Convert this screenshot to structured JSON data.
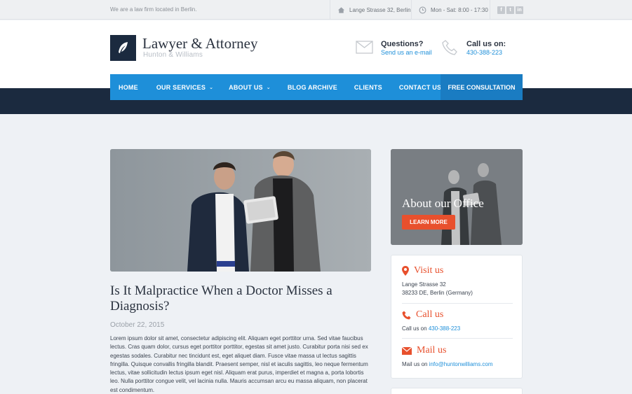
{
  "topbar": {
    "tagline": "We are a law firm located in Berlin.",
    "address": "Lange Strasse 32, Berlin",
    "hours": "Mon - Sat: 8:00 - 17:30",
    "social": [
      "f",
      "t",
      "in"
    ]
  },
  "header": {
    "logo_title": "Lawyer & Attorney",
    "logo_subtitle": "Hunton & Williams",
    "questions_label": "Questions?",
    "questions_link": "Send us an e-mail",
    "call_label": "Call us on:",
    "call_number": "430-388-223"
  },
  "nav": {
    "items": [
      {
        "label": "HOME",
        "dropdown": false
      },
      {
        "label": "OUR SERVICES",
        "dropdown": true
      },
      {
        "label": "ABOUT US",
        "dropdown": true
      },
      {
        "label": "BLOG ARCHIVE",
        "dropdown": false
      },
      {
        "label": "CLIENTS",
        "dropdown": false
      },
      {
        "label": "CONTACT US",
        "dropdown": false
      }
    ],
    "cta": "FREE CONSULTATION"
  },
  "post": {
    "title": "Is It Malpractice When a Doctor Misses a Diagnosis?",
    "date": "October 22, 2015",
    "body": "Lorem ipsum dolor sit amet, consectetur adipiscing elit. Aliquam eget porttitor urna. Sed vitae faucibus lectus. Cras quam dolor, cursus eget porttitor porttitor, egestas sit amet justo. Curabitur porta nisi sed ex egestas sodales. Curabitur nec tincidunt est, eget aliquet diam. Fusce vitae massa ut lectus sagittis fringilla. Quisque convallis fringilla blandit. Praesent semper, nisl et iaculis sagittis, leo neque fermentum lectus, vitae sollicitudin lectus ipsum eget nisl. Aliquam erat purus, imperdiet et magna a, porta lobortis leo. Nulla porttitor congue velit, vel lacinia nulla. Mauris accumsan arcu eu massa aliquam, non placerat est condimentum."
  },
  "sidebar": {
    "office_title": "About our Office",
    "office_button": "LEARN MORE",
    "visit_heading": "Visit us",
    "visit_line1": "Lange Strasse 32",
    "visit_line2": "38233 DE, Berlin (Germany)",
    "call_heading": "Call us",
    "call_prefix": "Call us on",
    "call_number": "430-388-223",
    "mail_heading": "Mail us",
    "mail_prefix": "Mail us on",
    "mail_address": "info@huntonwilliams.com"
  },
  "colors": {
    "navy": "#1b2a3f",
    "blue": "#1e8fd9",
    "accent": "#e8502d"
  }
}
